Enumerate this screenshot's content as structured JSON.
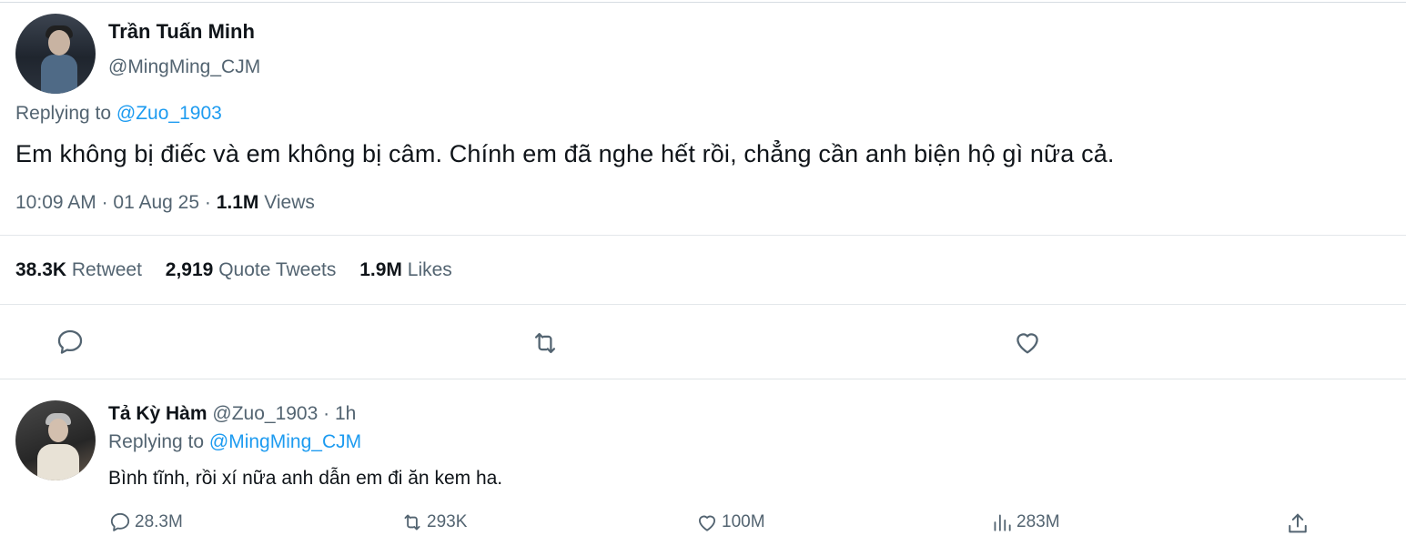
{
  "tweet": {
    "author_name": "Trần Tuấn Minh",
    "author_handle": "@MingMing_CJM",
    "replying_label": "Replying to",
    "replying_handle": "@Zuo_1903",
    "text": "Em không bị điếc và em không bị câm. Chính em đã nghe hết rồi, chẳng cần anh biện hộ gì nữa cả.",
    "time": "10:09 AM",
    "date": "01 Aug 25",
    "views_count": "1.1M",
    "views_label": "Views",
    "stats": {
      "retweet_count": "38.3K",
      "retweet_label": "Retweet",
      "quote_count": "2,919",
      "quote_label": "Quote Tweets",
      "likes_count": "1.9M",
      "likes_label": "Likes"
    },
    "actions": [
      "reply-icon",
      "retweet-icon",
      "like-icon"
    ]
  },
  "reply": {
    "author_name": "Tả Kỳ Hàm",
    "author_handle": "@Zuo_1903",
    "age": "1h",
    "replying_label": "Replying to",
    "replying_handle": "@MingMing_CJM",
    "text": "Bình tĩnh, rồi xí nữa anh dẫn em đi ăn kem ha.",
    "stats": {
      "replies": "28.3M",
      "retweets": "293K",
      "likes": "100M",
      "views": "283M"
    }
  },
  "colors": {
    "link": "#1d9bf0",
    "secondary_text": "#536471",
    "primary_text": "#0f1419",
    "divider": "#e3e7ea"
  }
}
